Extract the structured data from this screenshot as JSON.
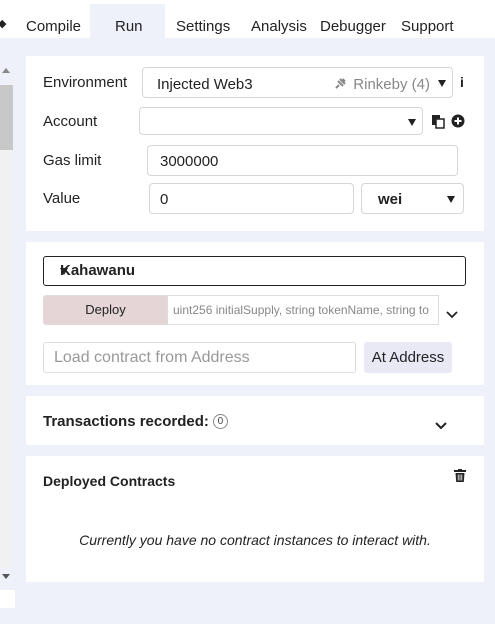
{
  "tabs": [
    {
      "label": "Compile"
    },
    {
      "label": "Run",
      "active": true
    },
    {
      "label": "Settings"
    },
    {
      "label": "Analysis"
    },
    {
      "label": "Debugger"
    },
    {
      "label": "Support"
    }
  ],
  "tab_overflow_glyph": "◆",
  "environment": {
    "label": "Environment",
    "value": "Injected Web3",
    "network": "Rinkeby (4)",
    "info_glyph": "i"
  },
  "account": {
    "label": "Account",
    "value": ""
  },
  "gas_limit": {
    "label": "Gas limit",
    "value": "3000000"
  },
  "value": {
    "label": "Value",
    "amount": "0",
    "unit": "wei"
  },
  "contract": {
    "selected": "Kahawanu"
  },
  "deploy": {
    "button_label": "Deploy",
    "args_placeholder": "uint256 initialSupply, string tokenName, string to"
  },
  "at_address": {
    "placeholder": "Load contract from Address",
    "button_label": "At Address"
  },
  "transactions": {
    "label": "Transactions recorded:",
    "count": "0"
  },
  "deployed": {
    "title": "Deployed Contracts",
    "empty_message": "Currently you have no contract instances to interact with."
  },
  "colors": {
    "background": "#eef0fa",
    "panel": "#ffffff",
    "deploy_button": "#e6d5d6",
    "at_address_button": "#e8e9f5"
  }
}
